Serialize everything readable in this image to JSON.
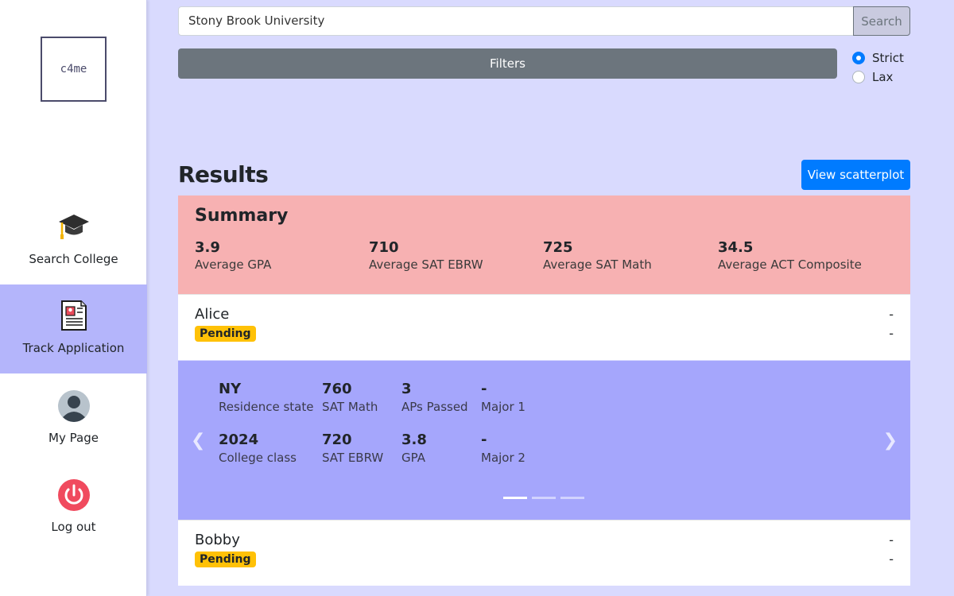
{
  "logo": {
    "text": "c4me"
  },
  "sidebar": {
    "items": [
      {
        "label": "Search College",
        "icon": "graduation-cap-icon",
        "active": false
      },
      {
        "label": "Track Application",
        "icon": "document-icon",
        "active": true
      },
      {
        "label": "My Page",
        "icon": "user-avatar-icon",
        "active": false
      },
      {
        "label": "Log out",
        "icon": "power-icon",
        "active": false
      }
    ]
  },
  "search": {
    "value": "Stony Brook University",
    "button_label": "Search"
  },
  "filters": {
    "button_label": "Filters"
  },
  "match_mode": {
    "options": [
      "Strict",
      "Lax"
    ],
    "selected": "Strict"
  },
  "results": {
    "title": "Results",
    "scatter_button_label": "View scatterplot"
  },
  "summary": {
    "title": "Summary",
    "stats": [
      {
        "value": "3.9",
        "label": "Average GPA"
      },
      {
        "value": "710",
        "label": "Average SAT EBRW"
      },
      {
        "value": "725",
        "label": "Average SAT Math"
      },
      {
        "value": "34.5",
        "label": "Average ACT Composite"
      }
    ]
  },
  "applicants": [
    {
      "name": "Alice",
      "status": "Pending",
      "right_lines": [
        "-",
        "-"
      ]
    },
    {
      "name": "Bobby",
      "status": "Pending",
      "right_lines": [
        "-",
        "-"
      ]
    }
  ],
  "detail": {
    "row1": [
      {
        "value": "NY",
        "label": "Residence state"
      },
      {
        "value": "760",
        "label": "SAT Math"
      },
      {
        "value": "3",
        "label": "APs Passed"
      },
      {
        "value": "-",
        "label": "Major 1"
      }
    ],
    "row2": [
      {
        "value": "2024",
        "label": "College class"
      },
      {
        "value": "720",
        "label": "SAT EBRW"
      },
      {
        "value": "3.8",
        "label": "GPA"
      },
      {
        "value": "-",
        "label": "Major 2"
      }
    ],
    "prev_icon": "chevron-left-icon",
    "next_icon": "chevron-right-icon",
    "slide_count": 3,
    "active_slide": 1
  },
  "colors": {
    "page_bg": "#d9dafe",
    "active_nav": "#b4b5fb",
    "summary_bg": "#f7b1b2",
    "carousel_bg": "#a5a6fc",
    "badge_pending": "#ffc107",
    "primary": "#007bff"
  }
}
